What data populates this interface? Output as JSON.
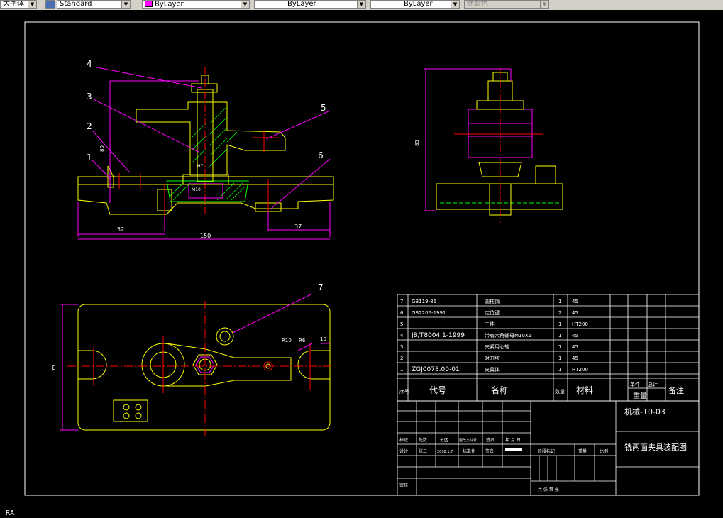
{
  "toolbar": {
    "style_label": "大字体",
    "textstyle_value": "Standard",
    "layer_value": "ByLayer",
    "linetype_value": "ByLayer",
    "lineweight_value": "ByLayer",
    "plotstyle_value": "随颜色",
    "layer_color": "#ff00ff"
  },
  "drawing": {
    "part_labels": [
      "1",
      "2",
      "3",
      "4",
      "5",
      "6",
      "7"
    ],
    "dims": {
      "d52": "52",
      "d150": "150",
      "d37": "37",
      "d85": "85",
      "d80": "80",
      "r10": "R10",
      "r6": "R6",
      "d10": "10",
      "d75": "75",
      "m10": "M10",
      "h7": "H7"
    },
    "bom": [
      {
        "no": "7",
        "code": "GB119-86",
        "name": "圆柱销",
        "qty": "1",
        "material": "45"
      },
      {
        "no": "6",
        "code": "GB2206-1991",
        "name": "定位键",
        "qty": "2",
        "material": "45"
      },
      {
        "no": "5",
        "code": "",
        "name": "工件",
        "qty": "1",
        "material": "HT200"
      },
      {
        "no": "4",
        "code": "JB/T8004.1-1999",
        "name": "带肩六角螺母M10X1",
        "qty": "1",
        "material": "45"
      },
      {
        "no": "3",
        "code": "",
        "name": "夹紧用心轴",
        "qty": "1",
        "material": "45"
      },
      {
        "no": "2",
        "code": "",
        "name": "对刀块",
        "qty": "1",
        "material": "45"
      },
      {
        "no": "1",
        "code": "ZGJ0078.00-01",
        "name": "夹具体",
        "qty": "1",
        "material": "HT200"
      }
    ],
    "bom_header": {
      "no": "序号",
      "code": "代号",
      "name": "名称",
      "qty": "数量",
      "material": "材料",
      "single": "单件",
      "total": "总计",
      "weight": "重量",
      "remark": "备注"
    },
    "title_block": {
      "drawing_no": "机械-10-03",
      "title": "铣两面夹具装配图",
      "mark": "标记",
      "count": "处数",
      "zone": "分区",
      "change_no": "更改文件号",
      "sign": "签名",
      "date_label": "年.月.日",
      "design": "设计",
      "designer": "张三",
      "design_date": "2008.1.7",
      "standardize": "标准化",
      "stage_mark": "阶段标记",
      "weight": "重量",
      "scale": "比例",
      "review": "审核",
      "sheets": "共  张  第  张"
    }
  },
  "command_line": "RA"
}
